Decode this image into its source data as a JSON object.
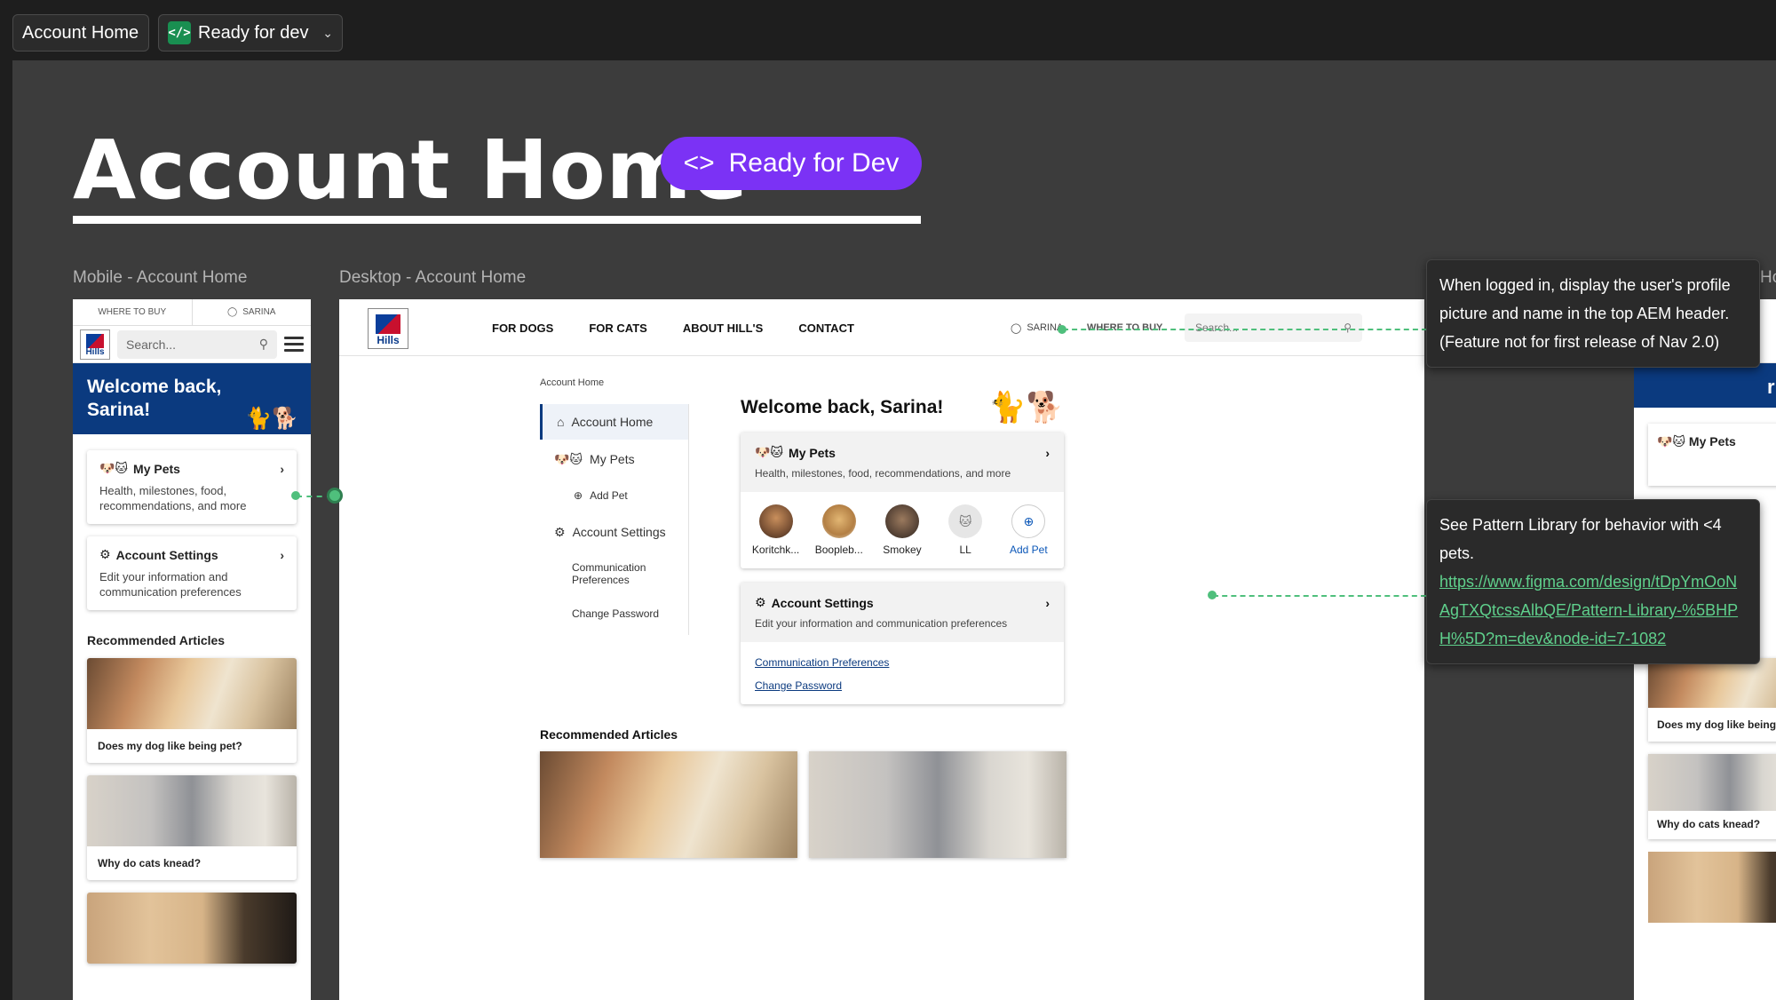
{
  "topbar": {
    "page_chip": "Account Home",
    "status_chip": "Ready for dev",
    "dev_icon_glyph": "</>"
  },
  "header": {
    "title": "Account Home",
    "status_pill": "Ready for Dev",
    "pill_glyph": "<>"
  },
  "frames": {
    "mobile_label": "Mobile - Account Home",
    "desktop_label": "Desktop - Account Home",
    "right_label_fragment": "Ho"
  },
  "site": {
    "logo_text": "Hills",
    "util_where": "WHERE TO BUY",
    "util_user": "SARINA",
    "search_placeholder": "Search...",
    "nav": [
      "FOR DOGS",
      "FOR CATS",
      "ABOUT HILL'S",
      "CONTACT"
    ],
    "breadcrumb": "Account Home",
    "welcome_mobile": "Welcome back, Sarina!",
    "welcome_desktop": "Welcome back, Sarina!",
    "sidebar": {
      "account_home": "Account Home",
      "my_pets": "My Pets",
      "add_pet": "Add Pet",
      "account_settings": "Account Settings",
      "comm_prefs": "Communication Preferences",
      "change_password": "Change Password"
    },
    "my_pets_card": {
      "title": "My Pets",
      "subtitle_mobile": "Health, milestones, food, recommendations, and more",
      "subtitle_desktop": "Health, milestones, food, recommendations, and more"
    },
    "pets": [
      {
        "name": "Koritchk..."
      },
      {
        "name": "Boopleb..."
      },
      {
        "name": "Smokey"
      },
      {
        "name": "LL"
      }
    ],
    "add_pet_label": "Add Pet",
    "settings_card": {
      "title": "Account Settings",
      "subtitle_mobile": "Edit your information and communication preferences",
      "subtitle_desktop": "Edit your information and communication preferences",
      "link_comm": "Communication Preferences",
      "link_password": "Change Password"
    },
    "recommended_title": "Recommended Articles",
    "articles": [
      {
        "title": "Does my dog like being pet?"
      },
      {
        "title": "Why do cats knead?"
      }
    ],
    "right_frame_text": {
      "welcome_fragment": "rir",
      "my_pets": "My Pets",
      "article1": "Does my dog like being",
      "article2": "Why do cats knead?"
    }
  },
  "annotations": {
    "note1": "When logged in, display the user's profile picture and name in the top AEM header. (Feature not for first release of Nav 2.0)",
    "note2_text": "See Pattern Library for behavior with <4 pets.",
    "note2_link": "https://www.figma.com/design/tDpYmOoNAgTXQtcssAlbQE/Pattern-Library-%5BHPH%5D?m=dev&node-id=7-1082"
  },
  "colors": {
    "canvas": "#3c3c3c",
    "accent_purple": "#7b32f5",
    "brand_blue": "#0b3a7f",
    "annotation_green": "#4fbf7c"
  }
}
